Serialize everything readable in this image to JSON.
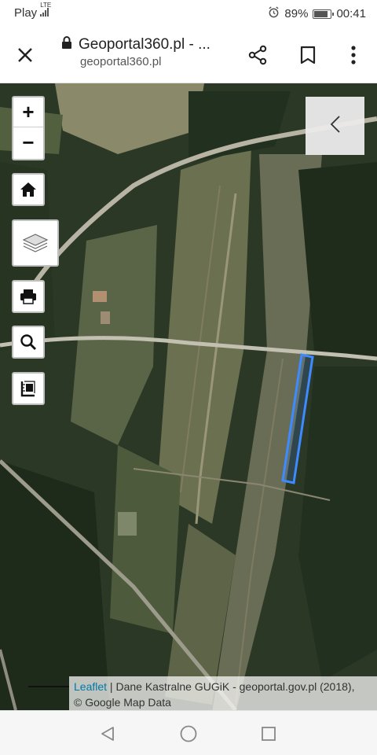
{
  "status_bar": {
    "carrier": "Play",
    "network": "LTE",
    "battery": "89%",
    "battery_level": 0.89,
    "time": "00:41"
  },
  "browser": {
    "title": "Geoportal360.pl - ...",
    "url": "geoportal360.pl",
    "icons": {
      "close": "close-icon",
      "lock": "lock-icon",
      "share": "share-icon",
      "bookmark": "bookmark-icon",
      "menu": "more-vert-icon"
    }
  },
  "map": {
    "controls": {
      "zoom_in": "+",
      "zoom_out": "−",
      "icons": [
        "home-icon",
        "layers-icon",
        "print-icon",
        "search-icon",
        "ruler-icon"
      ]
    },
    "panel_toggle_icon": "chevron-left-icon",
    "highlight_color": "#3d8bff",
    "attribution": {
      "link": "Leaflet",
      "text": " | Dane Kastralne GUGiK - geoportal.gov.pl (2018),",
      "line2": "© Google Map Data"
    }
  },
  "nav_bar": {
    "icons": [
      "back-triangle-icon",
      "home-circle-icon",
      "recents-square-icon"
    ]
  }
}
